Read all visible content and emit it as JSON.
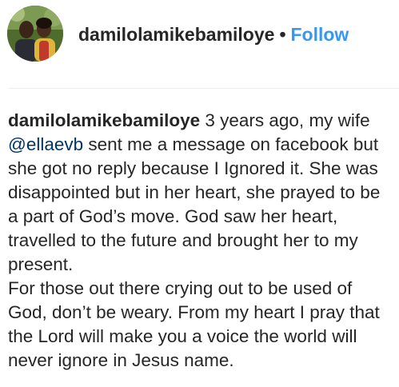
{
  "post": {
    "username": "damilolamikebamiloye",
    "separator": "•",
    "follow_label": "Follow"
  },
  "caption": {
    "username": "damilolamikebamiloye",
    "text_before_mention": " 3 years ago, my wife ",
    "mention": "@ellaevb",
    "text_after_mention": " sent me a message on facebook but she got no reply because I Ignored it. She was disappointed but in her heart, she prayed to be a part of God’s move. God saw her heart, travelled to the future and brought her to my present.",
    "paragraph2": "For those out there crying out to be used of God, don’t be weary. From my heart I pray that the Lord will make you a voice the world will never ignore in Jesus name."
  },
  "colors": {
    "follow": "#3897f0",
    "mention": "#003569",
    "text": "#262626"
  }
}
